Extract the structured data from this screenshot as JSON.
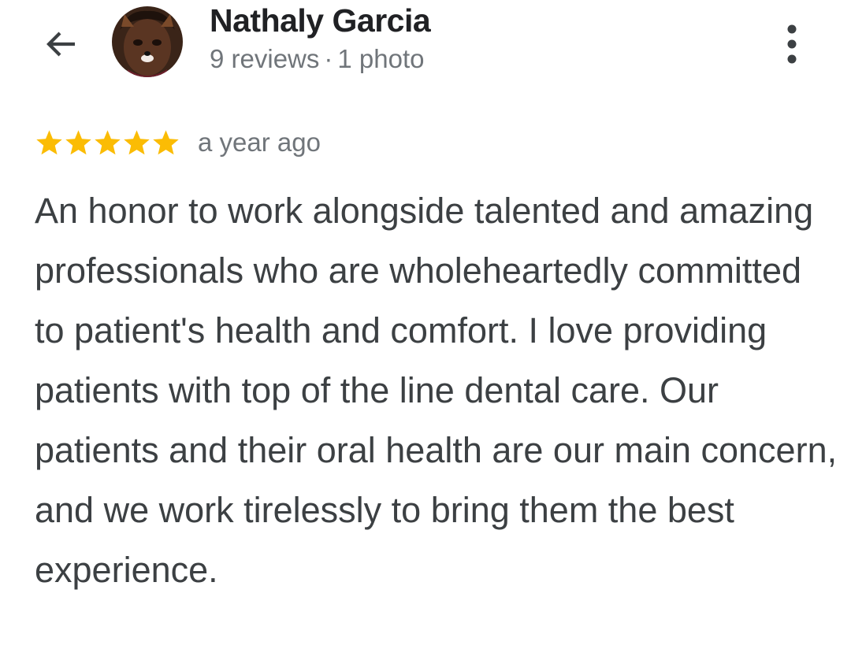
{
  "header": {
    "back_icon": "arrow-left-icon",
    "reviewer_name": "Nathaly Garcia",
    "reviews_count": "9 reviews",
    "separator": "·",
    "photos_count": "1 photo",
    "more_icon": "more-vert-icon"
  },
  "review": {
    "rating": 5,
    "rating_max": 5,
    "time_ago": "a year ago",
    "text": "An honor to work alongside talented and amazing professionals who are wholeheartedly committed to patient's health and comfort. I love providing patients with top of the line dental care. Our patients and their oral health are our main concern, and we work tirelessly to bring them the best experience."
  },
  "colors": {
    "star": "#fbbc04",
    "primary_text": "#202124",
    "secondary_text": "#70757a",
    "body_text": "#3c4043"
  }
}
